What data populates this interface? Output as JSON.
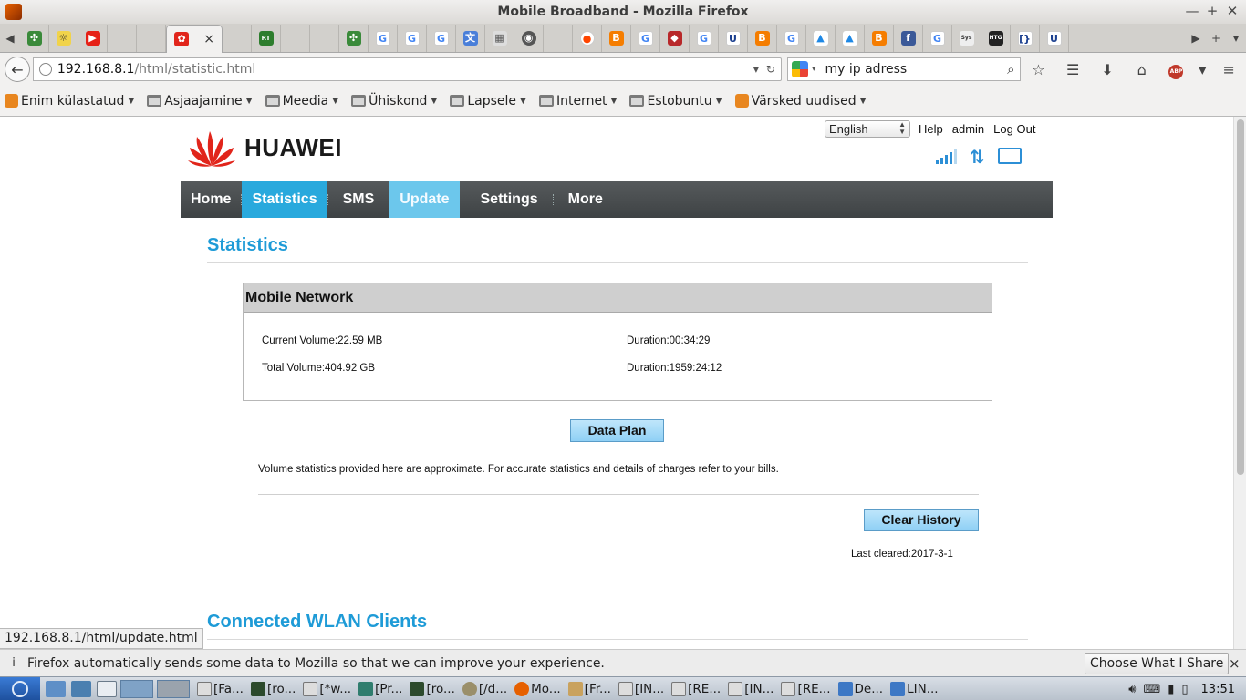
{
  "window": {
    "title": "Mobile Broadband - Mozilla Firefox"
  },
  "icons": {
    "app": "firefox-icon",
    "minimize": "minimize-icon",
    "maximize": "maximize-icon",
    "close": "close-icon"
  },
  "tabs": {
    "close_glyph": "×"
  },
  "navbar": {
    "url_host": "192.168.8.1",
    "url_path": "/html/statistic.html",
    "search_value": "my ip adress"
  },
  "bookmarks": [
    {
      "label": "Enim külastatud",
      "icon": "most-visited-icon"
    },
    {
      "label": "Asjaajamine",
      "icon": "folder-icon"
    },
    {
      "label": "Meedia",
      "icon": "folder-icon"
    },
    {
      "label": "Ühiskond",
      "icon": "folder-icon"
    },
    {
      "label": "Lapsele",
      "icon": "folder-icon"
    },
    {
      "label": "Internet",
      "icon": "folder-icon"
    },
    {
      "label": "Estobuntu",
      "icon": "folder-icon"
    },
    {
      "label": "Värsked uudised",
      "icon": "rss-icon"
    }
  ],
  "router": {
    "language": "English",
    "top_links": {
      "help": "Help",
      "admin": "admin",
      "logout": "Log Out"
    },
    "brand": "HUAWEI",
    "menu": [
      {
        "label": "Home",
        "state": "normal"
      },
      {
        "label": "Statistics",
        "state": "active"
      },
      {
        "label": "SMS",
        "state": "normal"
      },
      {
        "label": "Update",
        "state": "hover"
      },
      {
        "label": "Settings",
        "state": "normal"
      },
      {
        "label": "More",
        "state": "normal"
      }
    ],
    "page_title": "Statistics",
    "panel": {
      "title": "Mobile Network",
      "current_volume": "Current Volume:22.59 MB",
      "current_duration": "Duration:00:34:29",
      "total_volume": "Total Volume:404.92 GB",
      "total_duration": "Duration:1959:24:12"
    },
    "data_plan_button": "Data Plan",
    "note": "Volume statistics provided here are approximate. For accurate statistics and details of charges refer to your bills.",
    "clear_history_button": "Clear History",
    "last_cleared": "Last cleared:2017-3-1",
    "wlan_title": "Connected WLAN Clients",
    "colors": {
      "accent": "#1e9bd7",
      "menu_bg": "#4a4e50",
      "active_tab": "#29a9dd",
      "brand_red": "#e1251b"
    }
  },
  "status_link": "192.168.8.1/html/update.html",
  "notification": {
    "info_glyph": "i",
    "message": "Firefox automatically sends some data to Mozilla so that we can improve your experience.",
    "button": "Choose What I Share",
    "close_glyph": "×"
  },
  "taskbar": {
    "tasks": [
      "[Fa...",
      "[ro...",
      "[*w...",
      "[Pr...",
      "[ro...",
      "[/d...",
      "Mo...",
      "[Fr...",
      "[IN...",
      "[RE...",
      "[IN...",
      "[RE...",
      "De...",
      "LIN..."
    ],
    "clock": "13:51"
  }
}
